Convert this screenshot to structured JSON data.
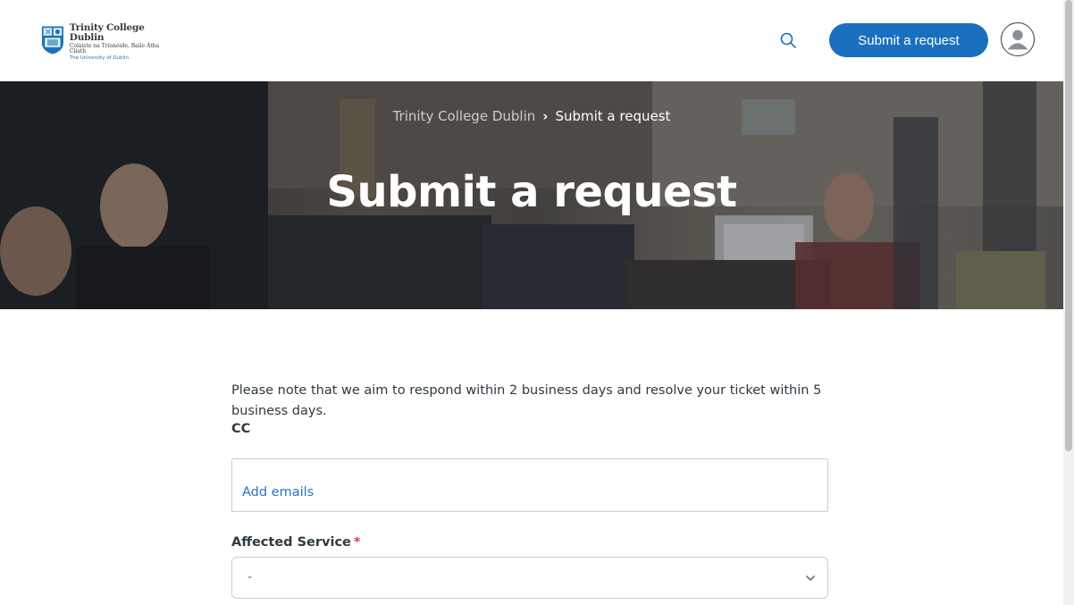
{
  "header": {
    "logo": {
      "line1": "Trinity College Dublin",
      "line2": "Coláiste na Tríonóide, Baile Átha Cliath",
      "line3": "The University of Dublin"
    },
    "search_icon": "search-icon",
    "submit_label": "Submit a request",
    "avatar_icon": "user-icon"
  },
  "hero": {
    "breadcrumb": {
      "home": "Trinity College Dublin",
      "current": "Submit a request"
    },
    "title": "Submit a request"
  },
  "form": {
    "notice": "Please note that we aim to respond within 2 business days and resolve your ticket within 5 business days.",
    "cc": {
      "label": "CC",
      "placeholder": "Add emails"
    },
    "affected_service": {
      "label": "Affected Service",
      "required_mark": "*",
      "selected": "-"
    }
  },
  "colors": {
    "accent": "#1a6fbf",
    "required": "#d93f4c",
    "text": "#2f3941"
  }
}
